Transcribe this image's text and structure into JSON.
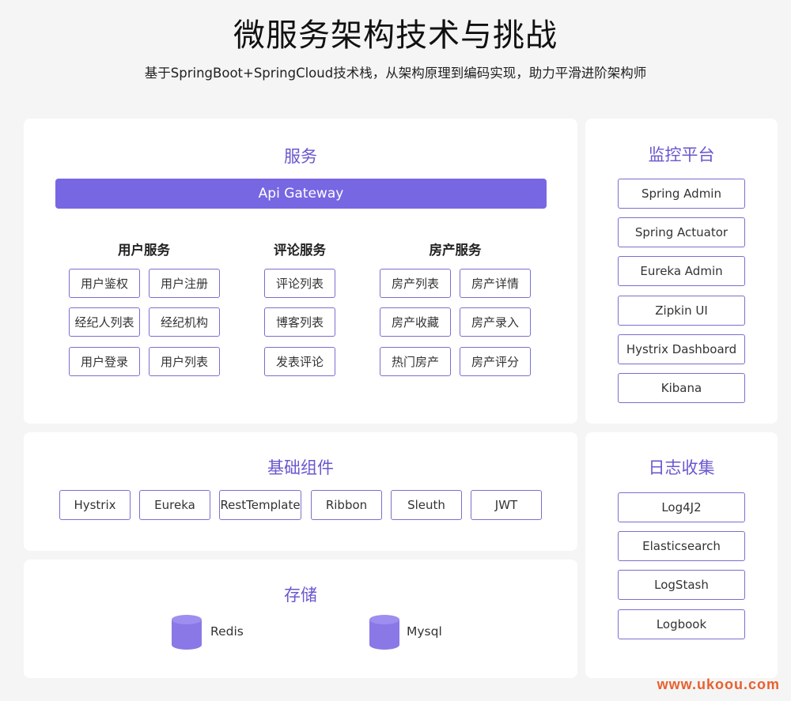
{
  "header": {
    "title": "微服务架构技术与挑战",
    "subtitle": "基于SpringBoot+SpringCloud技术栈，从架构原理到编码实现，助力平滑进阶架构师"
  },
  "services": {
    "title": "服务",
    "gateway": "Api Gateway",
    "groups": [
      {
        "title": "用户服务",
        "items": [
          "用户鉴权",
          "用户注册",
          "经纪人列表",
          "经纪机构",
          "用户登录",
          "用户列表"
        ]
      },
      {
        "title": "评论服务",
        "items": [
          "评论列表",
          "博客列表",
          "发表评论"
        ]
      },
      {
        "title": "房产服务",
        "items": [
          "房产列表",
          "房产详情",
          "房产收藏",
          "房产录入",
          "热门房产",
          "房产评分"
        ]
      }
    ]
  },
  "monitoring": {
    "title": "监控平台",
    "items": [
      "Spring  Admin",
      "Spring  Actuator",
      "Eureka  Admin",
      "Zipkin  UI",
      "Hystrix  Dashboard",
      "Kibana"
    ]
  },
  "components": {
    "title": "基础组件",
    "items": [
      "Hystrix",
      "Eureka",
      "RestTemplate",
      "Ribbon",
      "Sleuth",
      "JWT"
    ]
  },
  "logging": {
    "title": "日志收集",
    "items": [
      "Log4J2",
      "Elasticsearch",
      "LogStash",
      "Logbook"
    ]
  },
  "storage": {
    "title": "存储",
    "items": [
      "Redis",
      "Mysql"
    ]
  },
  "watermark": "www.ukoou.com",
  "colors": {
    "accent": "#7767e2",
    "title_purple": "#6a57cf",
    "box_border": "#7a6fd0",
    "watermark": "#e8612c"
  }
}
